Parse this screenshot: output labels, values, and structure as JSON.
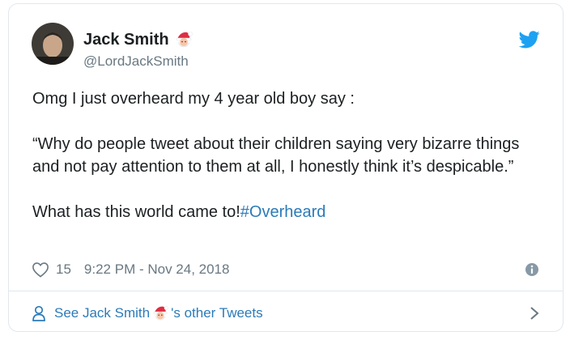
{
  "tweet": {
    "author_name": "Jack Smith",
    "author_handle": "@LordJackSmith",
    "text_line1": "Omg I just overheard my 4 year old boy say :",
    "quote": "“Why do people tweet about their children saying very bizarre things and not pay attention to them at all, I honestly think it’s despicable.”",
    "closing": "What has this world came to!",
    "hashtag": "#Overheard",
    "likes": "15",
    "timestamp": "9:22 PM - Nov 24, 2018"
  },
  "footer": {
    "prefix": "See Jack Smith",
    "suffix": "'s other Tweets"
  },
  "icons": {
    "brand": "twitter-icon",
    "emoji": "santa-emoji",
    "like": "heart-icon",
    "info": "info-icon",
    "profile": "person-icon",
    "more": "chevron-right-icon"
  },
  "colors": {
    "link": "#2b7bb9",
    "twitter_blue": "#1da1f2",
    "secondary_text": "#697882"
  }
}
